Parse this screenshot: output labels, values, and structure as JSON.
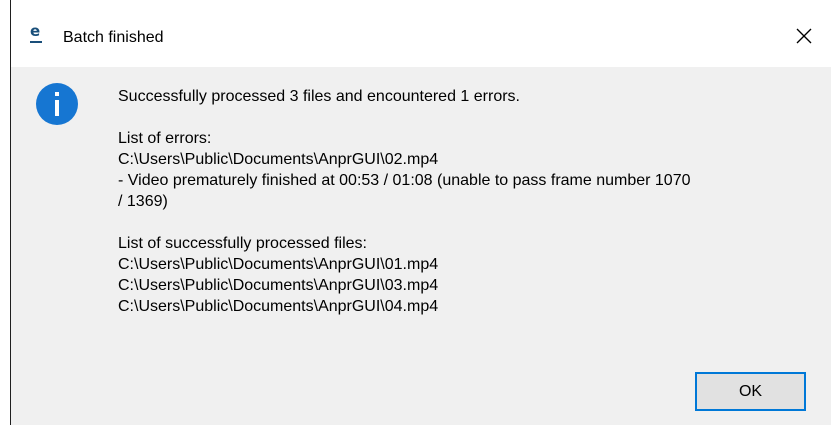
{
  "window": {
    "title": "Batch finished",
    "app_icon": "app-e-icon",
    "close_icon": "close-icon",
    "close_glyph": "✕"
  },
  "dialog": {
    "info_icon": "info-icon",
    "info_glyph": "i",
    "accent_color": "#1676d2",
    "summary": "Successfully processed 3 files and encountered 1 errors.",
    "errors_heading": "List of errors:",
    "errors": [
      {
        "path": "C:\\Users\\Public\\Documents\\AnprGUI\\02.mp4",
        "detail_line1": " - Video prematurely finished at 00:53 / 01:08 (unable to pass frame number 1070",
        "detail_line2": "/ 1369)"
      }
    ],
    "success_heading": "List of successfully processed files:",
    "success_files": [
      "C:\\Users\\Public\\Documents\\AnprGUI\\01.mp4",
      "C:\\Users\\Public\\Documents\\AnprGUI\\03.mp4",
      "C:\\Users\\Public\\Documents\\AnprGUI\\04.mp4"
    ]
  },
  "buttons": {
    "ok_label": "OK"
  }
}
